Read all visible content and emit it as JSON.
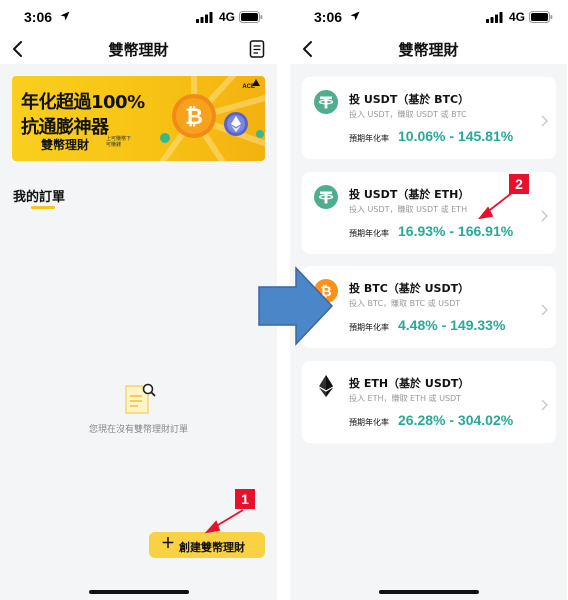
{
  "status_bar": {
    "time": "3:06",
    "network": "4G"
  },
  "left_screen": {
    "title": "雙幣理財",
    "banner": {
      "headline_1": "年化超過100%",
      "headline_2": "抗通膨神器",
      "subline": "雙幣理財",
      "fine_print": "上可賺幣下可賺錢",
      "brand": "ACE"
    },
    "section_title": "我的訂單",
    "empty_message": "您現在沒有雙幣理財訂單",
    "create_button": {
      "icon": "＋",
      "label": "創建雙幣理財"
    }
  },
  "right_screen": {
    "title": "雙幣理財",
    "products": [
      {
        "icon": "tether-icon",
        "title": "投 USDT（基於 BTC）",
        "subtitle": "投入 USDT，賺取 USDT 或 BTC",
        "rate_label": "預期年化率",
        "rate_range": "10.06% - 145.81%"
      },
      {
        "icon": "tether-icon",
        "title": "投 USDT（基於 ETH）",
        "subtitle": "投入 USDT，賺取 USDT 或 ETH",
        "rate_label": "預期年化率",
        "rate_range": "16.93% - 166.91%"
      },
      {
        "icon": "bitcoin-icon",
        "title": "投 BTC（基於 USDT）",
        "subtitle": "投入 BTC，賺取 BTC 或 USDT",
        "rate_label": "預期年化率",
        "rate_range": "4.48% - 149.33%"
      },
      {
        "icon": "ethereum-icon",
        "title": "投 ETH（基於 USDT）",
        "subtitle": "投入 ETH，賺取 ETH 或 USDT",
        "rate_label": "預期年化率",
        "rate_range": "26.28% - 304.02%"
      }
    ]
  },
  "annotations": {
    "marker_1": "1",
    "marker_2": "2"
  },
  "colors": {
    "accent_yellow": "#f9d243",
    "rate_green": "#26a996",
    "tether_green": "#4fae8e",
    "bitcoin_orange": "#f7931a",
    "marker_red": "#e8102b",
    "arrow_blue": "#4a86c8"
  }
}
